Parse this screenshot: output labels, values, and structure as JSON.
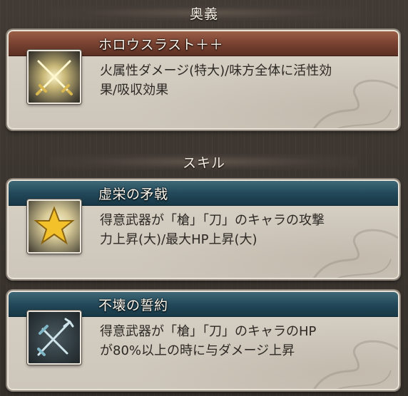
{
  "sections": {
    "ougi_title": "奥義",
    "skill_title": "スキル"
  },
  "ougi": {
    "name": "ホロウスラスト＋＋",
    "desc_line1": "火属性ダメージ(特大)/味方全体に活性効",
    "desc_line2": "果/吸収効果",
    "icon": "crossed-swords-icon"
  },
  "skills": [
    {
      "name": "虚栄の矛戟",
      "desc_line1": "得意武器が「槍」「刀」のキャラの攻撃",
      "desc_line2": "力上昇(大)/最大HP上昇(大)",
      "icon": "gold-star-icon"
    },
    {
      "name": "不壊の誓約",
      "desc_line1": "得意武器が「槍」「刀」のキャラのHP",
      "desc_line2": "が80%以上の時に与ダメージ上昇",
      "icon": "crossed-spear-sword-icon"
    }
  ],
  "colors": {
    "ougi_banner": "#7c4433",
    "skill_banner": "#23495a",
    "card_bg": "#d2ccc1",
    "page_bg": "#3b3530"
  }
}
